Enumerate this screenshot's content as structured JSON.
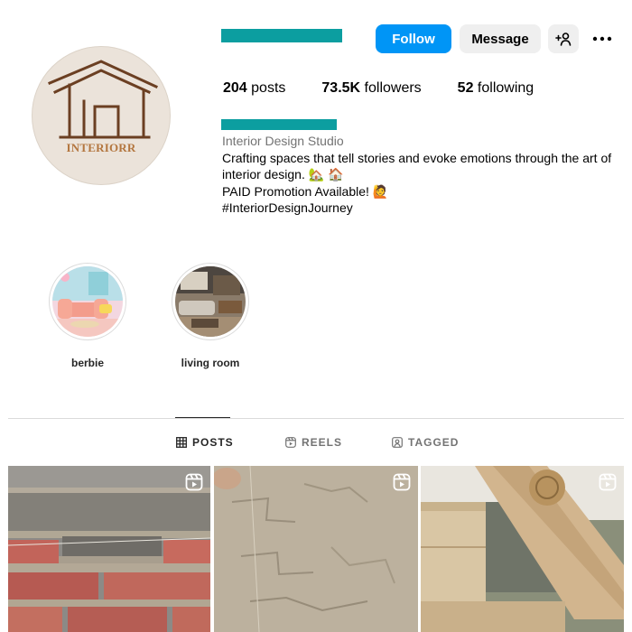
{
  "profile": {
    "avatar_text": "INTERIORR",
    "username_hidden": true,
    "display_name_hidden": true
  },
  "actions": {
    "follow_label": "Follow",
    "message_label": "Message"
  },
  "stats": {
    "posts_count": "204",
    "posts_label": " posts",
    "followers_count": "73.5K",
    "followers_label": " followers",
    "following_count": "52",
    "following_label": " following"
  },
  "bio": {
    "category": "Interior Design Studio",
    "line1": "Crafting spaces that tell stories and evoke emotions through the art of interior design. 🏡 🏠",
    "line2": "PAID Promotion Available! 🙋",
    "line3": "#InteriorDesignJourney"
  },
  "highlights": [
    {
      "label": "berbie"
    },
    {
      "label": "living room"
    }
  ],
  "tabs": [
    {
      "label": "POSTS",
      "active": true
    },
    {
      "label": "REELS",
      "active": false
    },
    {
      "label": "TAGGED",
      "active": false
    }
  ],
  "colors": {
    "accent": "#0095f6",
    "redaction": "#0c9ea0",
    "avatar_bg": "#ebe3da",
    "avatar_brown": "#6b3f22",
    "avatar_text": "#b3763f"
  },
  "icons": {
    "add_person": "add-person-icon",
    "more": "more-dots-icon",
    "posts_tab": "grid-icon",
    "reels_tab": "reels-icon",
    "tagged_tab": "tagged-icon",
    "post_reel": "reel-icon"
  }
}
